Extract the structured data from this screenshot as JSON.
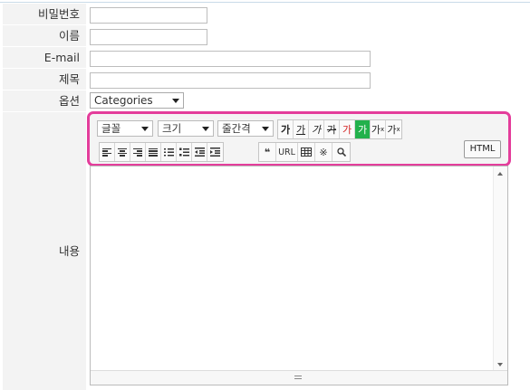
{
  "form": {
    "password_label": "비밀번호",
    "name_label": "이름",
    "email_label": "E-mail",
    "subject_label": "제목",
    "option_label": "옵션",
    "option_value": "Categories",
    "content_label": "내용"
  },
  "toolbar": {
    "font_select": "글꼴",
    "size_select": "크기",
    "line_spacing_select": "줄간격",
    "bold": "가",
    "underline": "가",
    "italic": "가",
    "strike": "가",
    "font_color": "가",
    "bg_color": "가",
    "superscript": "가",
    "subscript": "가",
    "sup_mark": "x",
    "sub_mark": "x",
    "quote": "❝",
    "url": "URL",
    "special_char": "※",
    "html": "HTML"
  },
  "colors": {
    "highlight_border": "#e43d9b",
    "font_color_sample": "#d22020",
    "bg_color_sample": "#22b14c"
  },
  "icons": [
    "align-left-icon",
    "align-center-icon",
    "align-right-icon",
    "align-justify-icon",
    "ordered-list-icon",
    "unordered-list-icon",
    "outdent-icon",
    "indent-icon",
    "quote-icon",
    "link-icon",
    "table-icon",
    "special-char-icon",
    "search-icon",
    "scroll-up-icon",
    "scroll-down-icon",
    "resize-grip-icon"
  ]
}
